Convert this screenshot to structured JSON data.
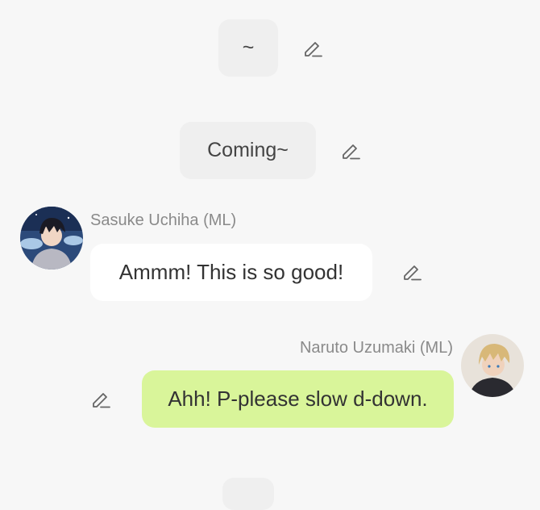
{
  "chat": {
    "narration_1": "~",
    "narration_2": "Coming~",
    "messages": [
      {
        "sender": "Sasuke Uchiha (ML)",
        "text": "Ammm! This is so good!",
        "side": "left"
      },
      {
        "sender": "Naruto Uzumaki (ML)",
        "text": "Ahh! P-please slow d-down.",
        "side": "right"
      }
    ]
  },
  "icons": {
    "edit": "pencil-edit-icon",
    "avatar_left": "sasuke-avatar",
    "avatar_right": "naruto-avatar"
  },
  "colors": {
    "background": "#f7f7f7",
    "narration_bubble": "#efefef",
    "left_bubble": "#ffffff",
    "right_bubble": "#d9f59a",
    "name_text": "#8a8a8a"
  }
}
